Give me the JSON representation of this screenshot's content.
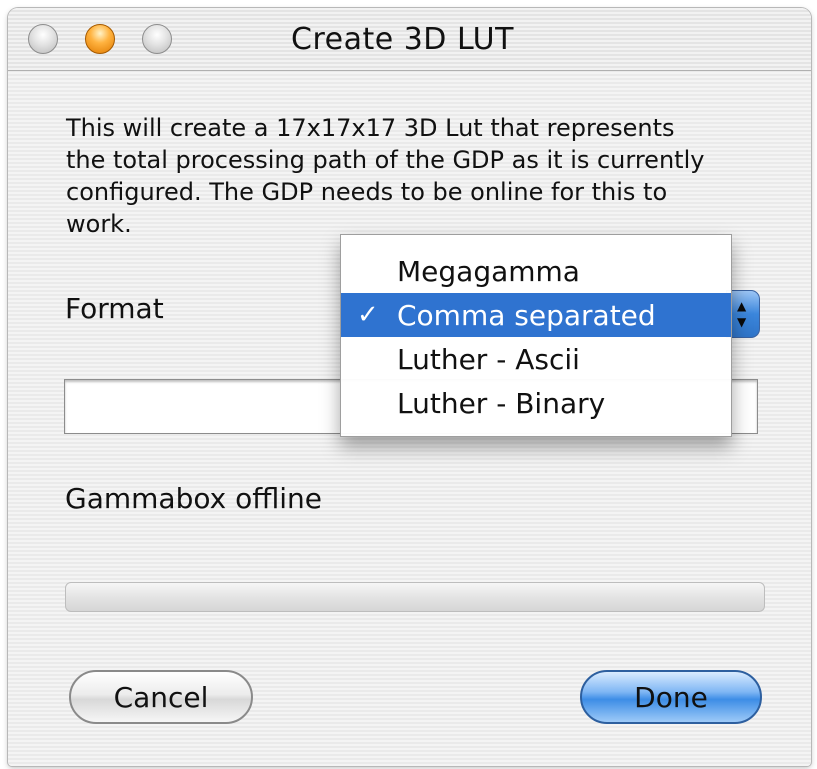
{
  "window": {
    "title": "Create 3D LUT",
    "controls": [
      "close-icon",
      "minimize-icon",
      "zoom-icon"
    ]
  },
  "description": {
    "lines": [
      "This will create a 17x17x17 3D Lut that represents",
      "the total processing path of the GDP as it is currently",
      "configured.  The GDP needs to be online for this to",
      "work."
    ]
  },
  "format": {
    "label": "Format",
    "selected": "Comma separated",
    "options": [
      "Megagamma",
      "Comma separated",
      "Luther - Ascii",
      "Luther - Binary"
    ],
    "checkmark": "✓"
  },
  "file_field": {
    "value": ""
  },
  "status": {
    "text": "Gammabox offline"
  },
  "progress": {
    "fraction": 0
  },
  "buttons": {
    "cancel_label": "Cancel",
    "done_label": "Done"
  },
  "colors": {
    "selection": "#2f73d0",
    "default_button": "#4c92e4",
    "minimize_light": "#ffb340"
  }
}
